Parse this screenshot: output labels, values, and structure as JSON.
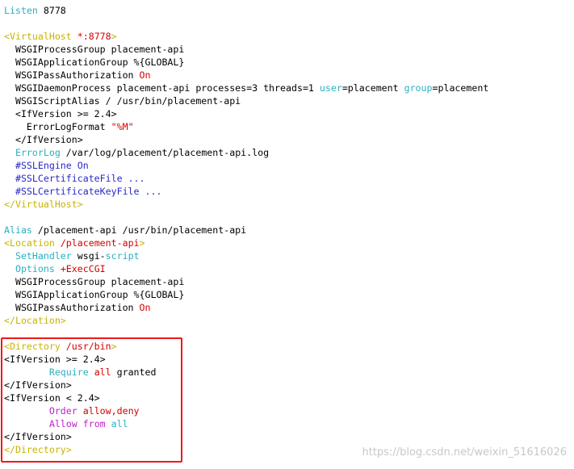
{
  "lines": [
    [
      [
        "Listen",
        "k"
      ],
      [
        " 8778",
        "n"
      ]
    ],
    [],
    [
      [
        "<VirtualHost ",
        "t"
      ],
      [
        "*:8778",
        "r"
      ],
      [
        ">",
        "t"
      ]
    ],
    [
      [
        "  WSGIProcessGroup placement-api",
        "n"
      ]
    ],
    [
      [
        "  WSGIApplicationGroup %{GLOBAL}",
        "n"
      ]
    ],
    [
      [
        "  WSGIPassAuthorization ",
        "n"
      ],
      [
        "On",
        "r"
      ]
    ],
    [
      [
        "  WSGIDaemonProcess placement-api processes=3 threads=1 ",
        "n"
      ],
      [
        "user",
        "k"
      ],
      [
        "=placement ",
        "n"
      ],
      [
        "group",
        "k"
      ],
      [
        "=placement",
        "n"
      ]
    ],
    [
      [
        "  WSGIScriptAlias / /usr/bin/placement-api",
        "n"
      ]
    ],
    [
      [
        "  <IfVersion >= 2.4>",
        "n"
      ]
    ],
    [
      [
        "    ErrorLogFormat ",
        "n"
      ],
      [
        "\"%M\"",
        "r"
      ]
    ],
    [
      [
        "  </IfVersion>",
        "n"
      ]
    ],
    [
      [
        "  ",
        "n"
      ],
      [
        "ErrorLog",
        "k"
      ],
      [
        " /var/log/placement/placement-api.log",
        "n"
      ]
    ],
    [
      [
        "  #SSLEngine On",
        "b"
      ]
    ],
    [
      [
        "  #SSLCertificateFile ...",
        "b"
      ]
    ],
    [
      [
        "  #SSLCertificateKeyFile ...",
        "b"
      ]
    ],
    [
      [
        "</VirtualHost>",
        "t"
      ]
    ],
    [],
    [
      [
        "Alias",
        "k"
      ],
      [
        " /placement-api /usr/bin/placement-api",
        "n"
      ]
    ],
    [
      [
        "<Location ",
        "t"
      ],
      [
        "/placement-api",
        "r"
      ],
      [
        ">",
        "t"
      ]
    ],
    [
      [
        "  ",
        "n"
      ],
      [
        "SetHandler",
        "k"
      ],
      [
        " wsgi-",
        "n"
      ],
      [
        "script",
        "k"
      ]
    ],
    [
      [
        "  ",
        "n"
      ],
      [
        "Options",
        "k"
      ],
      [
        " +ExecCGI",
        "r"
      ]
    ],
    [
      [
        "  WSGIProcessGroup placement-api",
        "n"
      ]
    ],
    [
      [
        "  WSGIApplicationGroup %{GLOBAL}",
        "n"
      ]
    ],
    [
      [
        "  WSGIPassAuthorization ",
        "n"
      ],
      [
        "On",
        "r"
      ]
    ],
    [
      [
        "</Location>",
        "t"
      ]
    ],
    [],
    [
      [
        "<Directory ",
        "t"
      ],
      [
        "/usr/bin",
        "r"
      ],
      [
        ">",
        "t"
      ]
    ],
    [
      [
        "<IfVersion >= 2.4>",
        "n"
      ]
    ],
    [
      [
        "        ",
        "n"
      ],
      [
        "Require",
        "k"
      ],
      [
        " all",
        "r"
      ],
      [
        " granted",
        "n"
      ]
    ],
    [
      [
        "</IfVersion>",
        "n"
      ]
    ],
    [
      [
        "<IfVersion < 2.4>",
        "n"
      ]
    ],
    [
      [
        "        ",
        "n"
      ],
      [
        "Order",
        "m"
      ],
      [
        " allow,deny",
        "r"
      ]
    ],
    [
      [
        "        ",
        "n"
      ],
      [
        "Allow",
        "m"
      ],
      [
        " from",
        "m"
      ],
      [
        " all",
        "k"
      ]
    ],
    [
      [
        "</IfVersion>",
        "n"
      ]
    ],
    [
      [
        "</Directory>",
        "t"
      ]
    ]
  ],
  "watermark": "https://blog.csdn.net/weixin_51616026",
  "colors": {
    "keyword": "#2ab0c0",
    "tag": "#c8b400",
    "value": "#d40000",
    "comment": "#2828c8",
    "access": "#c020c8",
    "highlight_box": "#f01818"
  }
}
